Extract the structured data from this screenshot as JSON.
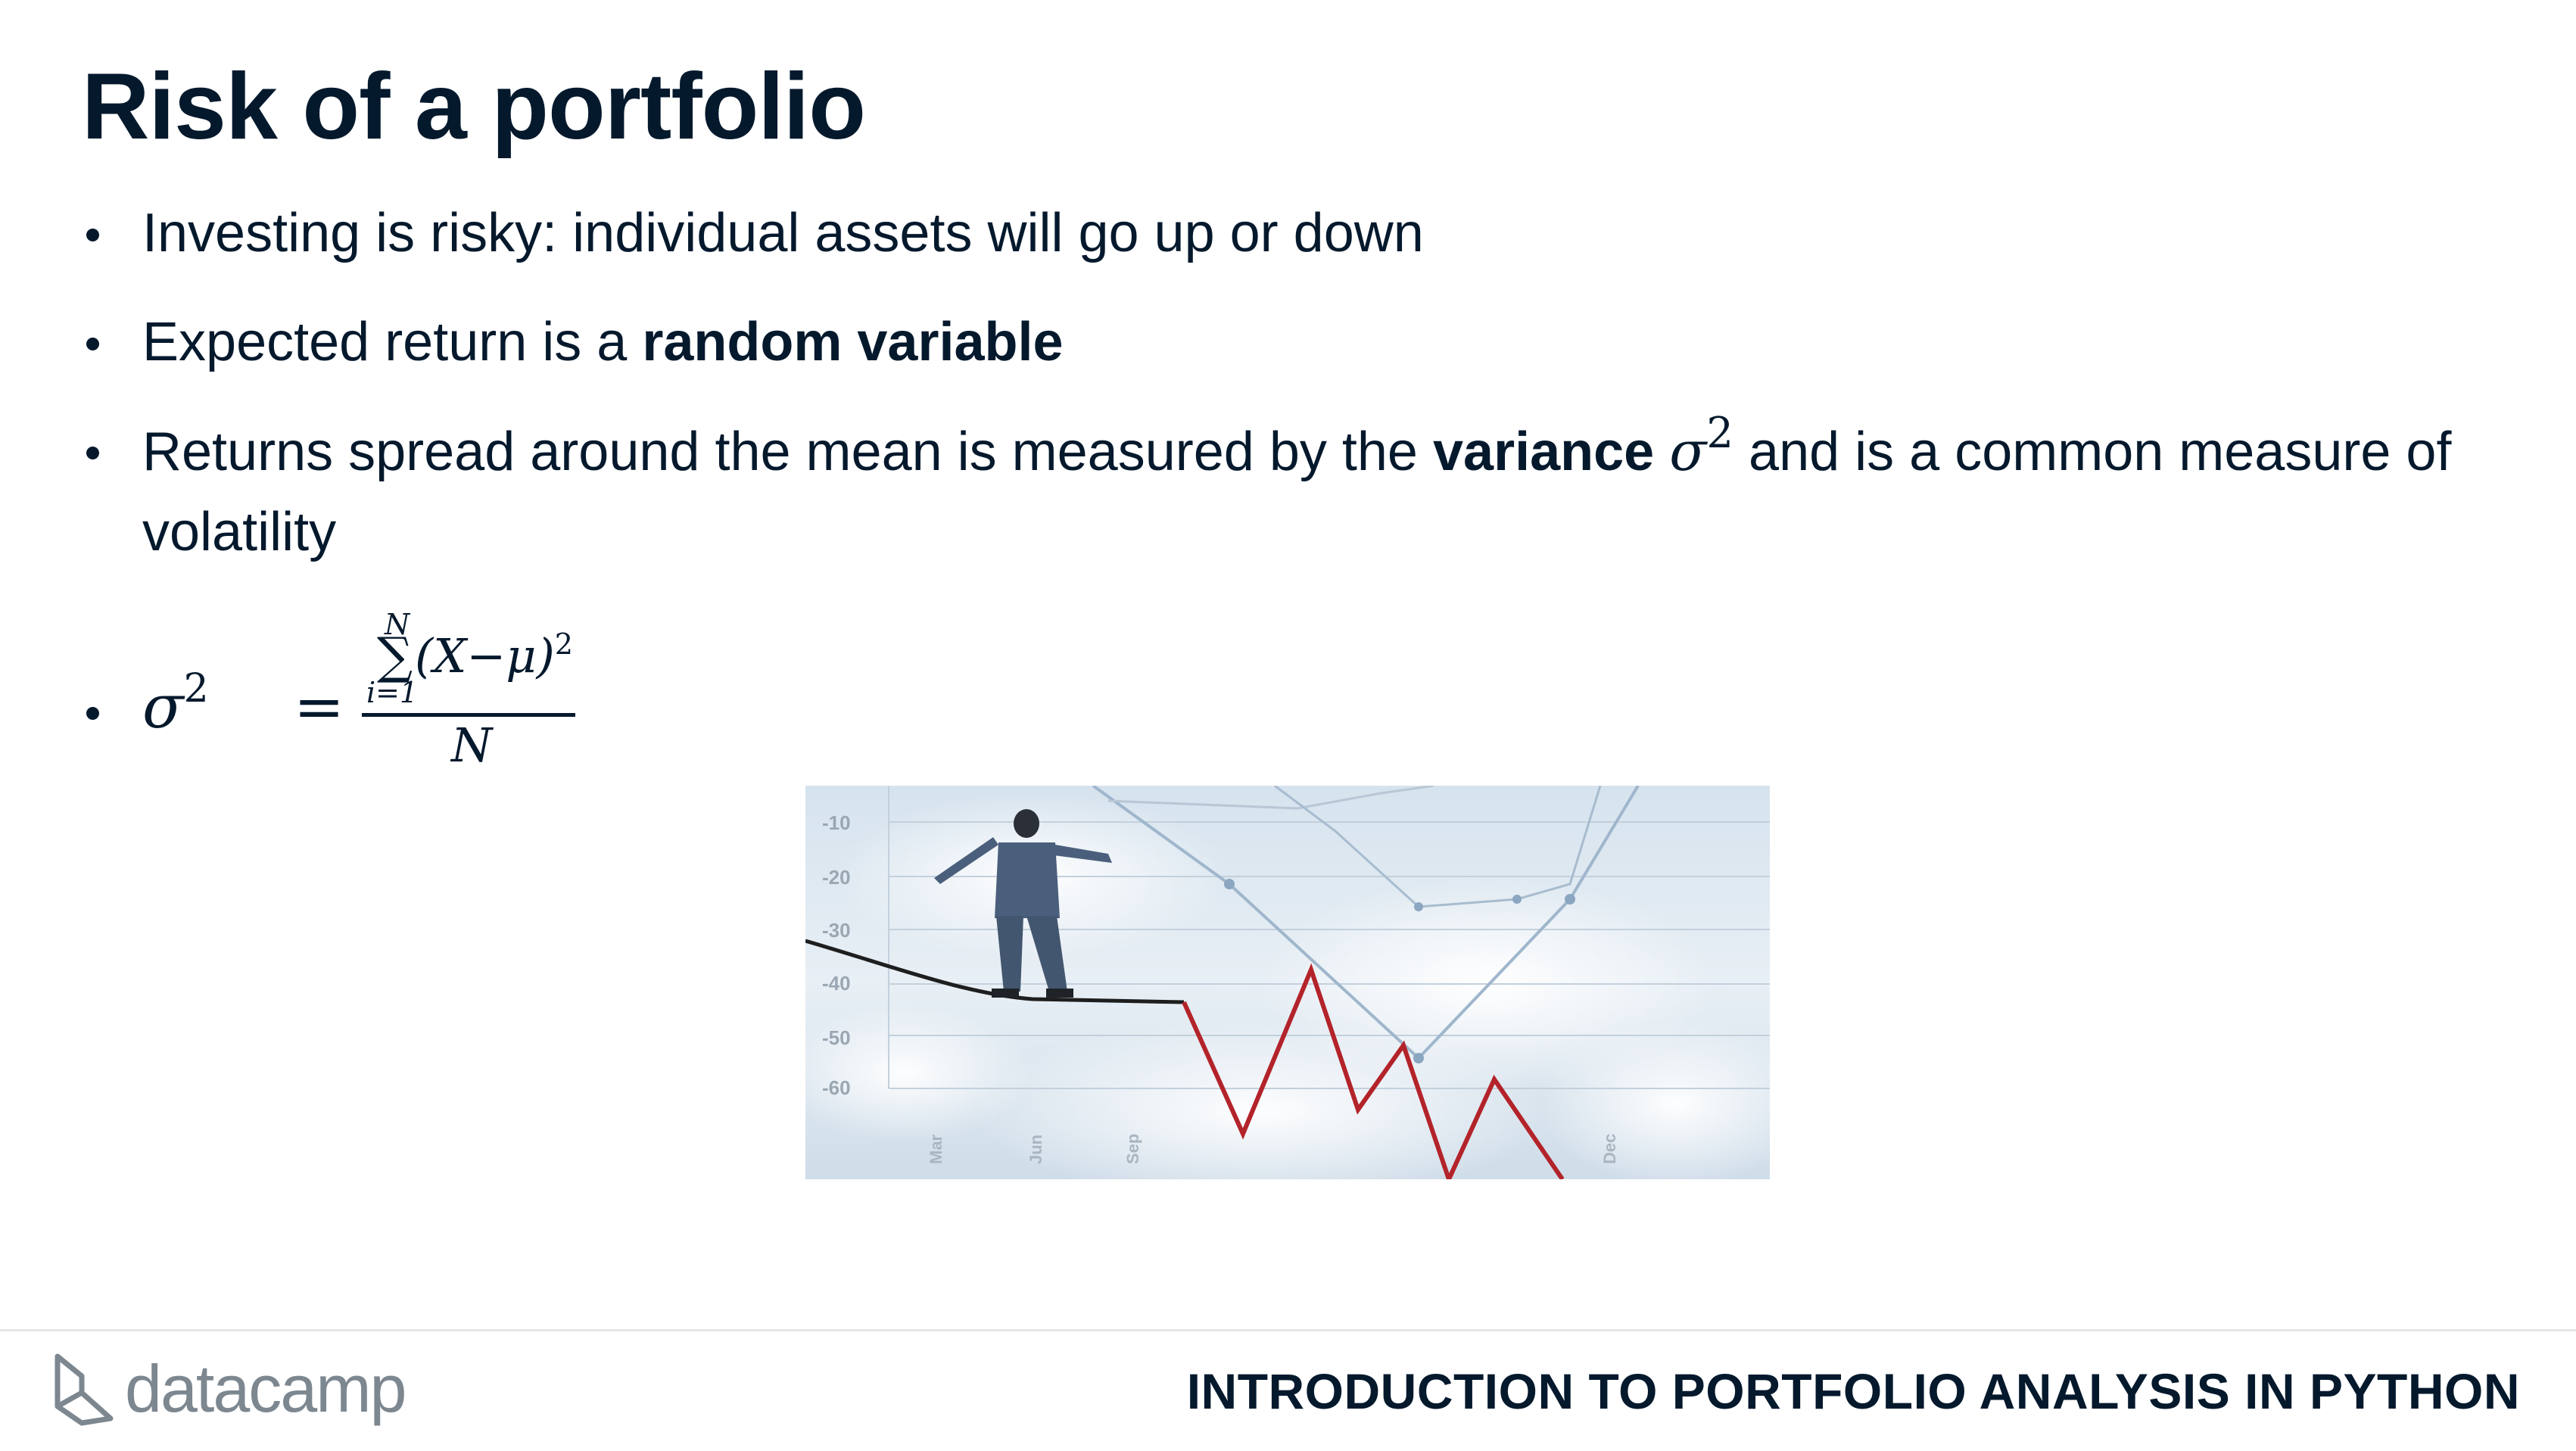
{
  "slide": {
    "title": "Risk of a portfolio",
    "bullets": {
      "b1": "Investing is risky: individual assets will go up or down",
      "b2_pre": "Expected return is a ",
      "b2_bold": "random variable",
      "b3_pre": "Returns spread around the mean is measured by the ",
      "b3_bold": "variance",
      "b3_sym": "σ",
      "b3_exp": "2",
      "b3_post": " and is a common measure of volatility"
    },
    "formula": {
      "lhs_sym": "σ",
      "lhs_exp": "2",
      "equals": "=",
      "sum_upper": "N",
      "sum_sign": "∑",
      "sum_lower": "i=1",
      "numerator": "(X−μ)",
      "numerator_exp": "2",
      "denominator": "N"
    }
  },
  "image": {
    "description_icon": "tightrope-walker-chart-image",
    "y_tick_labels": [
      "-10",
      "-20",
      "-30",
      "-40",
      "-50",
      "-60"
    ],
    "x_tick_labels": [
      "Mar",
      "Jun",
      "Sep",
      "Dec"
    ]
  },
  "footer": {
    "logo_text": "datacamp",
    "course_title": "INTRODUCTION TO PORTFOLIO ANALYSIS IN PYTHON"
  },
  "colors": {
    "text": "#05192d",
    "red_line": "#b3232a",
    "logo": "#7d8790"
  }
}
